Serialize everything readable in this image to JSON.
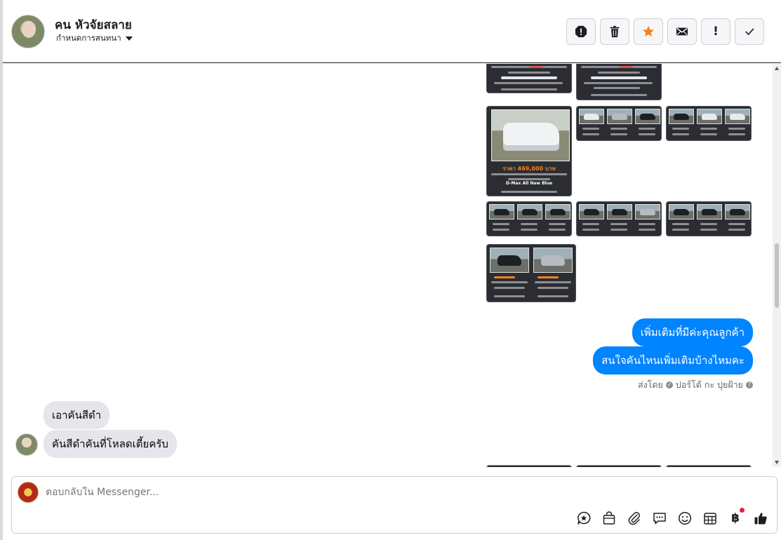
{
  "header": {
    "contact_name": "คน หัวจัยสลาย",
    "assign_label": "กำหนดการสนทนา",
    "actions": [
      {
        "name": "report-icon",
        "label": "!"
      },
      {
        "name": "trash-icon",
        "label": ""
      },
      {
        "name": "star-icon",
        "label": ""
      },
      {
        "name": "mail-icon",
        "label": ""
      },
      {
        "name": "exclamation-icon",
        "label": "!"
      },
      {
        "name": "check-icon",
        "label": ""
      }
    ]
  },
  "messages": {
    "outgoing": [
      "เพิ่มเติมที่มีค่ะคุณลูกค้า",
      "สนใจคันไหนเพิ่มเติมบ้างไหมคะ"
    ],
    "sent_by_prefix": "ส่งโดย",
    "sent_by_name": "ปอร์โต้ กะ ปุยฝ้าย",
    "incoming": [
      "เอาคันสีดำ",
      "คันสีดำคันที่โหลดเตี้ยครับ"
    ],
    "big_photo_price": "ราคา 469,000 บาท",
    "photo_model": "D-Max All New Blue"
  },
  "composer": {
    "placeholder": "ตอบกลับใน Messenger...",
    "tools": [
      "star-message-icon",
      "shopping-bag-icon",
      "paperclip-icon",
      "saved-reply-icon",
      "emoji-icon",
      "calendar-icon",
      "baht-icon",
      "like-icon"
    ]
  },
  "colors": {
    "accent": "#0084ff",
    "star": "#f5821f",
    "incoming_bubble": "#e4e6eb"
  }
}
